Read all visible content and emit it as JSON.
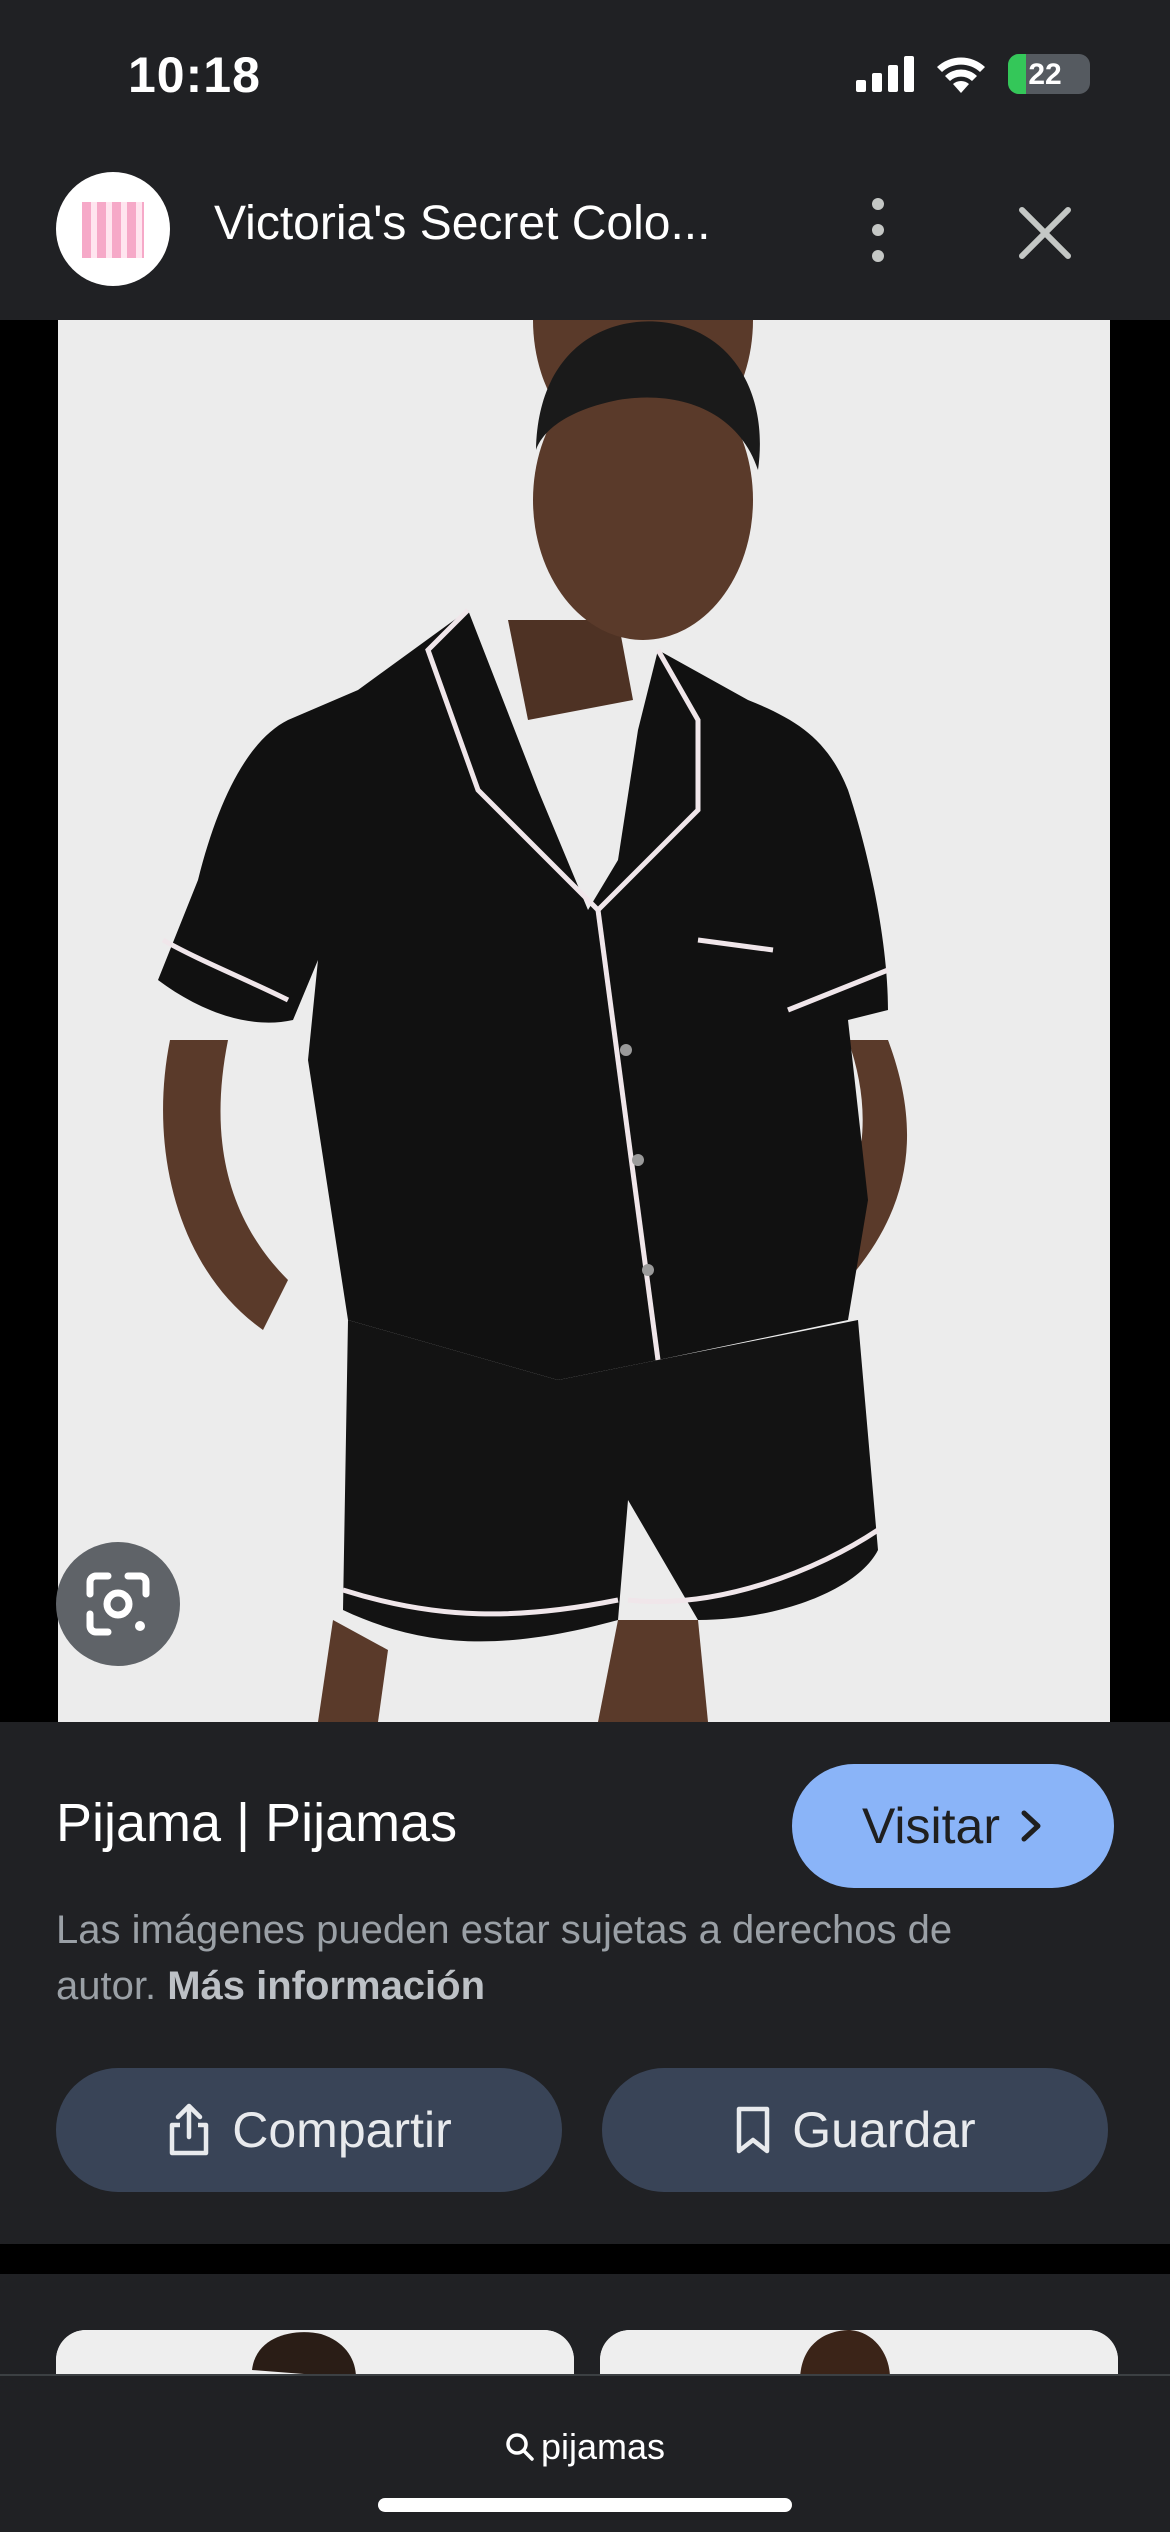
{
  "status_bar": {
    "time": "10:18",
    "battery_level": "22",
    "battery_fraction": 0.22,
    "icons": [
      "signal-icon",
      "wifi-icon",
      "battery-charging-icon"
    ]
  },
  "header": {
    "site_title": "Victoria's Secret Colo...",
    "icons": [
      "site-logo",
      "more-vert-icon",
      "close-icon"
    ]
  },
  "image": {
    "description_icon": "google-lens-icon"
  },
  "result": {
    "title": "Pijama | Pijamas",
    "visit_label": "Visitar",
    "copyright_text": "Las imágenes pueden estar sujetas a derechos de autor.",
    "more_info_label": "Más información"
  },
  "actions": {
    "share_label": "Compartir",
    "save_label": "Guardar"
  },
  "bottom_bar": {
    "search_query": "pijamas"
  },
  "colors": {
    "background": "#202124",
    "accent": "#8ab4f8",
    "action_button": "#394457",
    "battery_green": "#34c759"
  }
}
